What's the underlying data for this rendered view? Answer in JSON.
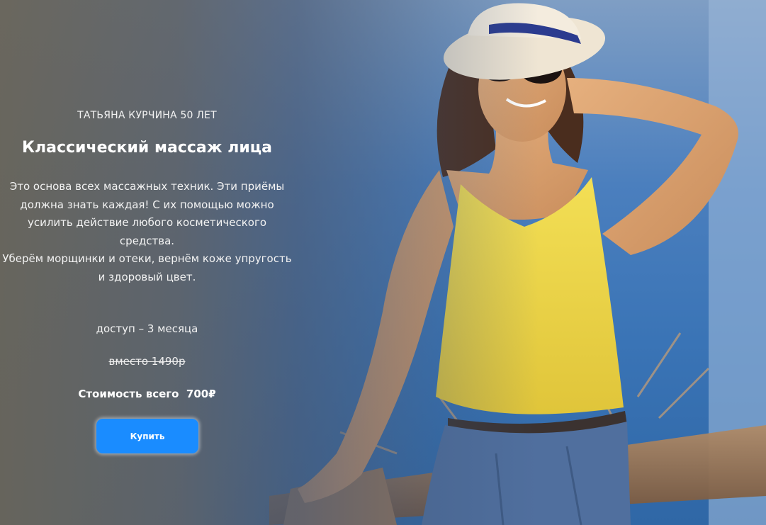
{
  "hero": {
    "author": "ТАТЬЯНА КУРЧИНА 50 ЛЕТ",
    "title": "Классический массаж лица",
    "description": [
      "Это основа всех массажных техник. Эти приёмы",
      "должна знать каждая! С их помощью можно",
      "усилить действие любого косметического",
      "средства.",
      "Уберём морщинки и отеки, вернём коже упругость",
      "и здоровый цвет."
    ],
    "access": "доступ – 3 месяца",
    "old_price": "вместо 1490р",
    "price": "Стоимость всего  700₽",
    "buy_label": "Купить"
  },
  "colors": {
    "button": "#1a8cff",
    "sky": "#3f6fa6",
    "top": "#f0d84a",
    "shorts": "#4f6f9e"
  },
  "image": {
    "subject": "woman-in-hat-and-yellow-top-photo"
  }
}
